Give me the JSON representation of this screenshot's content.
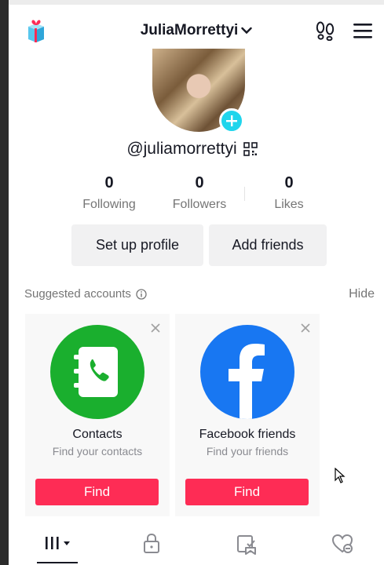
{
  "header": {
    "username": "JuliaMorrettyi"
  },
  "profile": {
    "handle": "@juliamorrettyi"
  },
  "stats": {
    "following": {
      "value": "0",
      "label": "Following"
    },
    "followers": {
      "value": "0",
      "label": "Followers"
    },
    "likes": {
      "value": "0",
      "label": "Likes"
    }
  },
  "actions": {
    "setup_profile": "Set up profile",
    "add_friends": "Add friends"
  },
  "suggested": {
    "title": "Suggested accounts",
    "hide": "Hide",
    "cards": [
      {
        "title": "Contacts",
        "subtitle": "Find your contacts",
        "button": "Find",
        "icon": "contacts-icon",
        "color": "#1aaf2e"
      },
      {
        "title": "Facebook friends",
        "subtitle": "Find your friends",
        "button": "Find",
        "icon": "facebook-icon",
        "color": "#1877f2"
      }
    ]
  },
  "tabs": [
    {
      "icon": "videos-grid-icon",
      "active": true
    },
    {
      "icon": "lock-icon"
    },
    {
      "icon": "reposts-icon"
    },
    {
      "icon": "liked-icon"
    }
  ],
  "colors": {
    "accent": "#fe2c55",
    "plus": "#20d5ec",
    "muted_text": "#757575"
  }
}
